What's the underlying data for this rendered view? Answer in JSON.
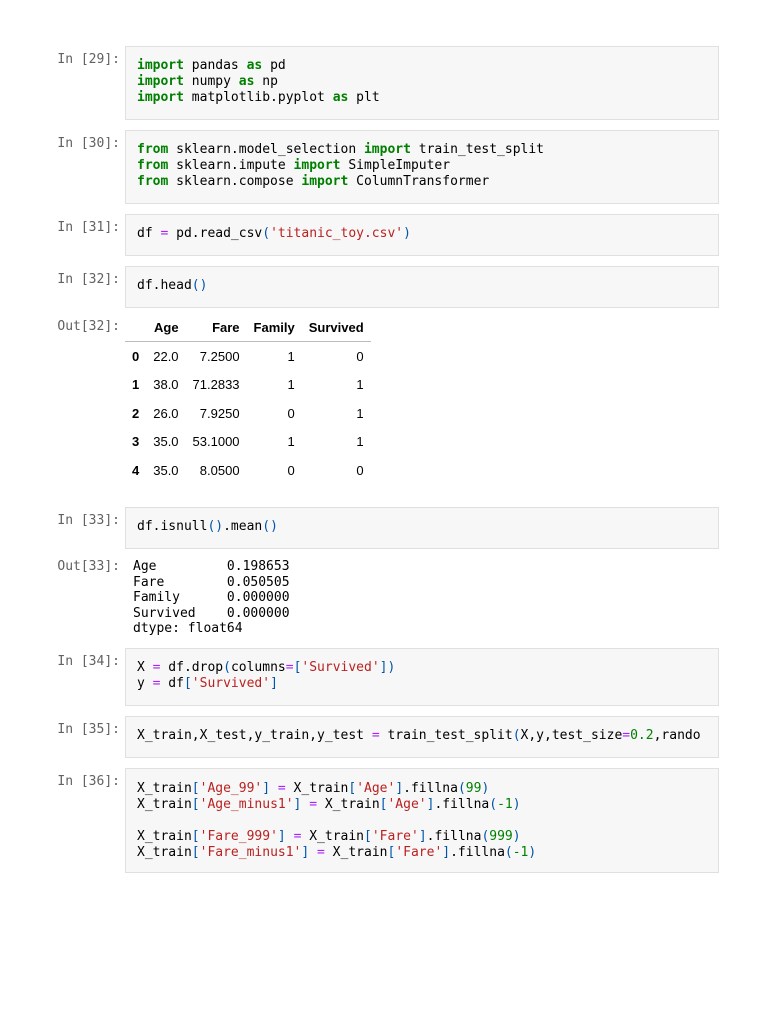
{
  "cells": [
    {
      "prompt": "In [29]:",
      "lines": [
        [
          {
            "t": "import",
            "c": "kw"
          },
          {
            "t": " pandas "
          },
          {
            "t": "as",
            "c": "kw"
          },
          {
            "t": " pd"
          }
        ],
        [
          {
            "t": "import",
            "c": "kw"
          },
          {
            "t": " numpy "
          },
          {
            "t": "as",
            "c": "kw"
          },
          {
            "t": " np"
          }
        ],
        [
          {
            "t": "import",
            "c": "kw"
          },
          {
            "t": " matplotlib.pyplot "
          },
          {
            "t": "as",
            "c": "kw"
          },
          {
            "t": " plt"
          }
        ]
      ]
    },
    {
      "prompt": "In [30]:",
      "lines": [
        [
          {
            "t": "from",
            "c": "kw"
          },
          {
            "t": " sklearn.model_selection "
          },
          {
            "t": "import",
            "c": "kw"
          },
          {
            "t": " train_test_split"
          }
        ],
        [
          {
            "t": "from",
            "c": "kw"
          },
          {
            "t": " sklearn.impute "
          },
          {
            "t": "import",
            "c": "kw"
          },
          {
            "t": " SimpleImputer"
          }
        ],
        [
          {
            "t": "from",
            "c": "kw"
          },
          {
            "t": " sklearn.compose "
          },
          {
            "t": "import",
            "c": "kw"
          },
          {
            "t": " ColumnTransformer"
          }
        ]
      ]
    },
    {
      "prompt": "In [31]:",
      "lines": [
        [
          {
            "t": "df "
          },
          {
            "t": "=",
            "c": "op"
          },
          {
            "t": " pd.read_csv"
          },
          {
            "t": "(",
            "c": "par"
          },
          {
            "t": "'titanic_toy.csv'",
            "c": "str"
          },
          {
            "t": ")",
            "c": "par"
          }
        ]
      ]
    },
    {
      "prompt": "In [32]:",
      "lines": [
        [
          {
            "t": "df.head"
          },
          {
            "t": "()",
            "c": "par"
          }
        ]
      ]
    },
    {
      "prompt": "In [33]:",
      "lines": [
        [
          {
            "t": "df.isnull"
          },
          {
            "t": "()",
            "c": "par"
          },
          {
            "t": ".mean"
          },
          {
            "t": "()",
            "c": "par"
          }
        ]
      ]
    },
    {
      "prompt": "In [34]:",
      "lines": [
        [
          {
            "t": "X "
          },
          {
            "t": "=",
            "c": "op"
          },
          {
            "t": " df.drop"
          },
          {
            "t": "(",
            "c": "par"
          },
          {
            "t": "columns"
          },
          {
            "t": "=",
            "c": "op"
          },
          {
            "t": "[",
            "c": "par"
          },
          {
            "t": "'Survived'",
            "c": "str"
          },
          {
            "t": "])",
            "c": "par"
          }
        ],
        [
          {
            "t": "y "
          },
          {
            "t": "=",
            "c": "op"
          },
          {
            "t": " df"
          },
          {
            "t": "[",
            "c": "par"
          },
          {
            "t": "'Survived'",
            "c": "str"
          },
          {
            "t": "]",
            "c": "par"
          }
        ]
      ]
    },
    {
      "prompt": "In [35]:",
      "lines": [
        [
          {
            "t": "X_train,X_test,y_train,y_test "
          },
          {
            "t": "=",
            "c": "op"
          },
          {
            "t": " train_test_split"
          },
          {
            "t": "(",
            "c": "par"
          },
          {
            "t": "X,y,test_size"
          },
          {
            "t": "=",
            "c": "op"
          },
          {
            "t": "0.2",
            "c": "num"
          },
          {
            "t": ",rando"
          }
        ]
      ]
    },
    {
      "prompt": "In [36]:",
      "lines": [
        [
          {
            "t": "X_train"
          },
          {
            "t": "[",
            "c": "par"
          },
          {
            "t": "'Age_99'",
            "c": "str"
          },
          {
            "t": "]",
            "c": "par"
          },
          {
            "t": " "
          },
          {
            "t": "=",
            "c": "op"
          },
          {
            "t": " X_train"
          },
          {
            "t": "[",
            "c": "par"
          },
          {
            "t": "'Age'",
            "c": "str"
          },
          {
            "t": "]",
            "c": "par"
          },
          {
            "t": ".fillna"
          },
          {
            "t": "(",
            "c": "par"
          },
          {
            "t": "99",
            "c": "num"
          },
          {
            "t": ")",
            "c": "par"
          }
        ],
        [
          {
            "t": "X_train"
          },
          {
            "t": "[",
            "c": "par"
          },
          {
            "t": "'Age_minus1'",
            "c": "str"
          },
          {
            "t": "]",
            "c": "par"
          },
          {
            "t": " "
          },
          {
            "t": "=",
            "c": "op"
          },
          {
            "t": " X_train"
          },
          {
            "t": "[",
            "c": "par"
          },
          {
            "t": "'Age'",
            "c": "str"
          },
          {
            "t": "]",
            "c": "par"
          },
          {
            "t": ".fillna"
          },
          {
            "t": "(",
            "c": "par"
          },
          {
            "t": "-1",
            "c": "num"
          },
          {
            "t": ")",
            "c": "par"
          }
        ],
        [],
        [
          {
            "t": "X_train"
          },
          {
            "t": "[",
            "c": "par"
          },
          {
            "t": "'Fare_999'",
            "c": "str"
          },
          {
            "t": "]",
            "c": "par"
          },
          {
            "t": " "
          },
          {
            "t": "=",
            "c": "op"
          },
          {
            "t": " X_train"
          },
          {
            "t": "[",
            "c": "par"
          },
          {
            "t": "'Fare'",
            "c": "str"
          },
          {
            "t": "]",
            "c": "par"
          },
          {
            "t": ".fillna"
          },
          {
            "t": "(",
            "c": "par"
          },
          {
            "t": "999",
            "c": "num"
          },
          {
            "t": ")",
            "c": "par"
          }
        ],
        [
          {
            "t": "X_train"
          },
          {
            "t": "[",
            "c": "par"
          },
          {
            "t": "'Fare_minus1'",
            "c": "str"
          },
          {
            "t": "]",
            "c": "par"
          },
          {
            "t": " "
          },
          {
            "t": "=",
            "c": "op"
          },
          {
            "t": " X_train"
          },
          {
            "t": "[",
            "c": "par"
          },
          {
            "t": "'Fare'",
            "c": "str"
          },
          {
            "t": "]",
            "c": "par"
          },
          {
            "t": ".fillna"
          },
          {
            "t": "(",
            "c": "par"
          },
          {
            "t": "-1",
            "c": "num"
          },
          {
            "t": ")",
            "c": "par"
          }
        ]
      ]
    }
  ],
  "out32": {
    "prompt": "Out[32]:",
    "columns": [
      "",
      "Age",
      "Fare",
      "Family",
      "Survived"
    ],
    "rows": [
      [
        "0",
        "22.0",
        "7.2500",
        "1",
        "0"
      ],
      [
        "1",
        "38.0",
        "71.2833",
        "1",
        "1"
      ],
      [
        "2",
        "26.0",
        "7.9250",
        "0",
        "1"
      ],
      [
        "3",
        "35.0",
        "53.1000",
        "1",
        "1"
      ],
      [
        "4",
        "35.0",
        "8.0500",
        "0",
        "0"
      ]
    ]
  },
  "out33": {
    "prompt": "Out[33]:",
    "text": "Age         0.198653\nFare        0.050505\nFamily      0.000000\nSurvived    0.000000\ndtype: float64"
  }
}
